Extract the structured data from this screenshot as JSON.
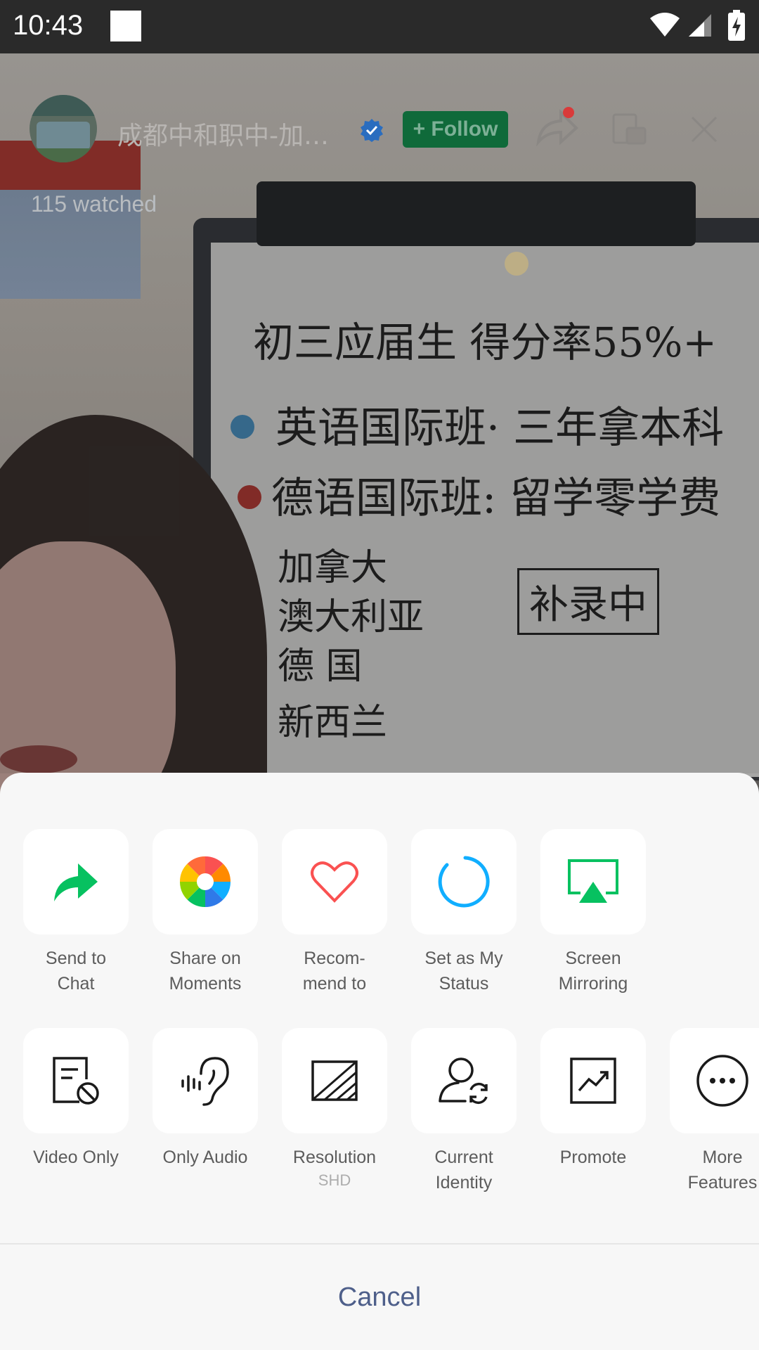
{
  "status_bar": {
    "time": "10:43",
    "icons": [
      "notification-square-icon",
      "wifi-icon",
      "cellular-signal-icon",
      "battery-charging-icon"
    ]
  },
  "live_header": {
    "host_name": "成都中和职中-加…",
    "follow_label": "+ Follow",
    "watched": "115 watched",
    "icons": [
      "verified-badge-icon",
      "share-icon",
      "floating-window-icon",
      "close-icon"
    ],
    "accent": "#07c160"
  },
  "whiteboard": {
    "lines": [
      "初三应届生 得分率55%+",
      "英语国际班· 三年拿本科",
      "德语国际班: 留学零学费",
      "加拿大",
      "澳大利亚",
      "德  国",
      "新西兰",
      "补录中"
    ]
  },
  "sheet": {
    "row1": [
      {
        "label": "Send to\nChat",
        "line1": "Send to",
        "line2": "Chat",
        "icon": "forward-arrow-icon"
      },
      {
        "label": "Share on Moments",
        "line1": "Share on",
        "line2": "Moments",
        "icon": "moments-shutter-icon"
      },
      {
        "label": "Recom-mend to",
        "line1": "Recom-",
        "line2": "mend to",
        "icon": "heart-icon"
      },
      {
        "label": "Set as My Status",
        "line1": "Set as My",
        "line2": "Status",
        "icon": "status-ring-icon"
      },
      {
        "label": "Screen Mirroring",
        "line1": "Screen",
        "line2": "Mirroring",
        "icon": "airplay-icon"
      }
    ],
    "row2": [
      {
        "line1": "Video Only",
        "line2": "",
        "icon": "video-only-icon"
      },
      {
        "line1": "Only Audio",
        "line2": "",
        "icon": "ear-audio-icon"
      },
      {
        "line1": "Resolution",
        "line2": "",
        "sub": "SHD",
        "icon": "resolution-icon"
      },
      {
        "line1": "Current",
        "line2": "Identity",
        "icon": "switch-identity-icon"
      },
      {
        "line1": "Promote",
        "line2": "",
        "icon": "promote-chart-icon"
      },
      {
        "line1": "More",
        "line2": "Features",
        "icon": "more-dots-icon"
      }
    ],
    "cancel_label": "Cancel"
  },
  "colors": {
    "green": "#07c160",
    "red": "#fa5151",
    "blue": "#10aeff",
    "cancel_text": "#4e5f8a",
    "sheet_bg": "#f7f7f7"
  }
}
